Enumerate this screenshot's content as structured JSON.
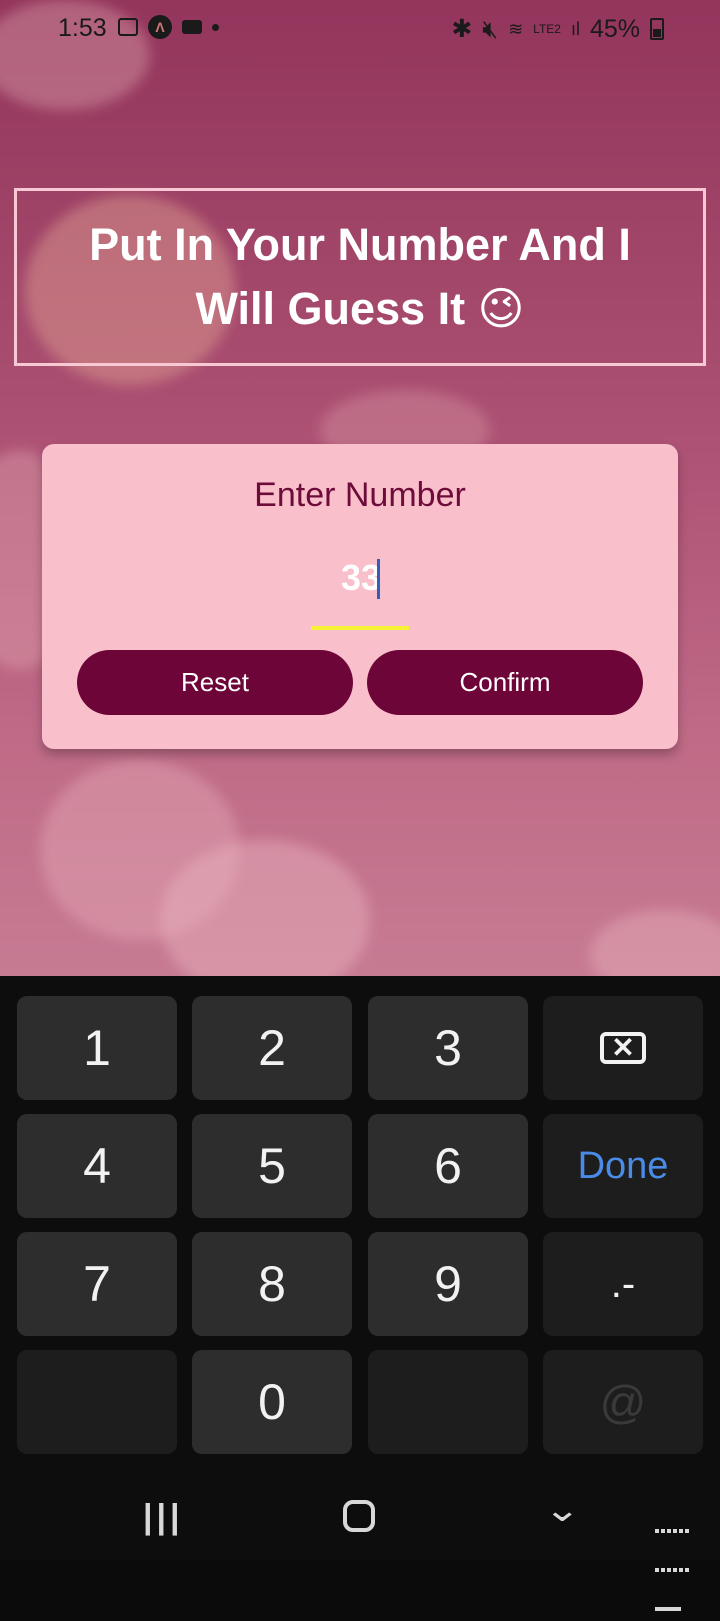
{
  "status_bar": {
    "time": "1:53",
    "battery": "45%",
    "network": "LTE2"
  },
  "title": "Put In Your Number And I Will Guess It 😉",
  "card": {
    "label": "Enter Number",
    "input_value": "33",
    "reset_label": "Reset",
    "confirm_label": "Confirm"
  },
  "keyboard": {
    "rows": [
      [
        "1",
        "2",
        "3",
        "backspace"
      ],
      [
        "4",
        "5",
        "6",
        "Done"
      ],
      [
        "7",
        "8",
        "9",
        ".-"
      ],
      [
        "",
        "0",
        "",
        "@"
      ]
    ],
    "key_1": "1",
    "key_2": "2",
    "key_3": "3",
    "key_4": "4",
    "key_5": "5",
    "key_6": "6",
    "key_7": "7",
    "key_8": "8",
    "key_9": "9",
    "key_0": "0",
    "key_done": "Done",
    "key_dot_dash": ".-",
    "key_at": "@"
  },
  "colors": {
    "accent": "#6e0538",
    "card_bg": "#f9bfcb",
    "underline": "#f6f233",
    "done_key": "#4a8be8"
  }
}
